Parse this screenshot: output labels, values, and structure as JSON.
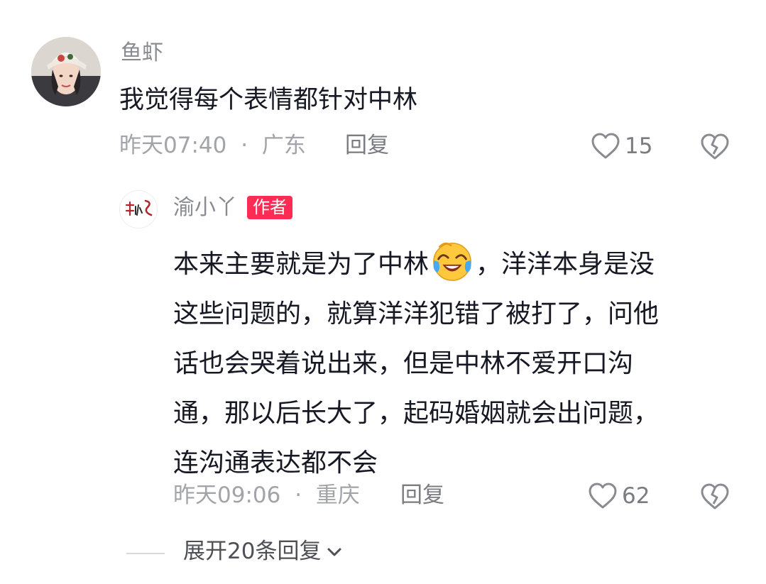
{
  "comment": {
    "username": "鱼虾",
    "text": "我觉得每个表情都针对中林",
    "time": "昨天07:40",
    "separator": "·",
    "location": "广东",
    "reply_label": "回复",
    "likes": "15",
    "icons": {
      "like": "heart-outline-icon",
      "dislike": "broken-heart-icon"
    }
  },
  "reply": {
    "username": "渝小丫",
    "badge": "作者",
    "lines": [
      "本来主要就是为了中林",
      "，洋洋本身是没",
      "这些问题的，就算洋洋犯错了被打了，问他",
      "话也会哭着说出来，但是中林不爱开口沟",
      "通，那以后长大了，起码婚姻就会出问题，",
      "连沟通表达都不会"
    ],
    "emoji": "crying-laughing-emoji",
    "time": "昨天09:06",
    "separator": "·",
    "location": "重庆",
    "reply_label": "回复",
    "likes": "62"
  },
  "expand": {
    "label": "展开20条回复",
    "icon": "chevron-down-icon"
  },
  "colors": {
    "badge": "#fe2c55",
    "text": "#161823",
    "secondary": "#a3a4a9"
  }
}
